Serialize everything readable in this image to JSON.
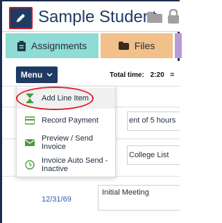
{
  "header": {
    "title": "Sample Student",
    "accent": "#1f3a63",
    "icons": [
      "pencil-icon",
      "folder-icon",
      "lock-icon"
    ]
  },
  "tabs": [
    {
      "label": "Assignments",
      "icon": "clipboard-icon",
      "color": "#8fdcd4"
    },
    {
      "label": "Files",
      "icon": "folder-icon",
      "color": "#f2c08a"
    }
  ],
  "toolbar": {
    "menu_label": "Menu",
    "total_time_label": "Total time:",
    "total_time_value": "2:20",
    "total_time_suffix": "="
  },
  "menu": {
    "items": [
      {
        "label": "Add Line Item",
        "icon": "hourglass-icon",
        "color": "#4a9d3c"
      },
      {
        "label": "Record Payment",
        "icon": "card-icon",
        "color": "#4a9d3c"
      },
      {
        "label": "Preview / Send Invoice",
        "icon": "envelope-icon",
        "color": "#4a9d3c"
      },
      {
        "label": "Invoice Auto Send - Inactive",
        "icon": "clock-icon",
        "color": "#4a9d3c"
      }
    ]
  },
  "rows": [
    {
      "text": "ent of 5 hours"
    },
    {
      "text": "College List"
    },
    {
      "date": "12/31/69",
      "note": "Initial Meeting"
    }
  ]
}
